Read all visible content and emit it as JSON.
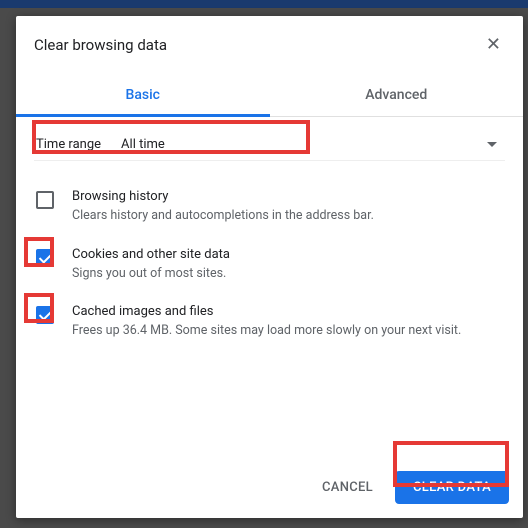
{
  "dialog": {
    "title": "Clear browsing data",
    "close_icon": "✕"
  },
  "tabs": {
    "basic": "Basic",
    "advanced": "Advanced"
  },
  "time": {
    "label": "Time range",
    "value": "All time"
  },
  "options": [
    {
      "title": "Browsing history",
      "desc": "Clears history and autocompletions in the address bar.",
      "checked": false
    },
    {
      "title": "Cookies and other site data",
      "desc": "Signs you out of most sites.",
      "checked": true
    },
    {
      "title": "Cached images and files",
      "desc": "Frees up 36.4 MB. Some sites may load more slowly on your next visit.",
      "checked": true
    }
  ],
  "footer": {
    "cancel": "CANCEL",
    "clear": "CLEAR DATA"
  }
}
